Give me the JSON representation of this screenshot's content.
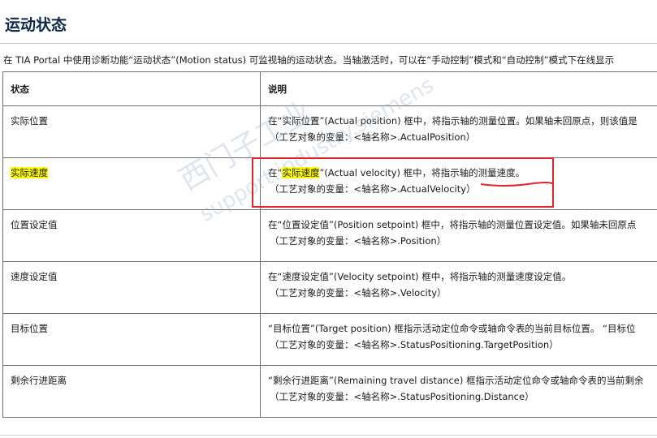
{
  "title": "运动状态",
  "intro": "在 TIA Portal 中使用诊断功能“运动状态”(Motion status) 可监视轴的运动状态。当轴激活时，可以在“手动控制”模式和“自动控制”模式下在线显示",
  "table": {
    "headers": [
      "状态",
      "说明"
    ],
    "rows": [
      {
        "status": "实际位置",
        "desc": "在“实际位置”(Actual position) 框中，将指示轴的测量位置。如果轴未回原点，则该值是",
        "var": "（工艺对象的变量：<轴名称>.ActualPosition）"
      },
      {
        "status": "实际速度",
        "desc_pre": "在“",
        "desc_hl": "实际速度",
        "desc_post": "”(Actual velocity) 框中，将指示轴的测量速度。",
        "var": "（工艺对象的变量：<轴名称>.ActualVelocity）"
      },
      {
        "status": "位置设定值",
        "desc": "在“位置设定值”(Position setpoint) 框中，将指示轴的测量位置设定值。如果轴未回原点",
        "var": "（工艺对象的变量：<轴名称>.Position）"
      },
      {
        "status": "速度设定值",
        "desc": "在“速度设定值”(Velocity setpoint) 框中，将指示轴的测量速度设定值。",
        "var": "（工艺对象的变量：<轴名称>.Velocity）"
      },
      {
        "status": "目标位置",
        "desc": "“目标位置”(Target position) 框指示活动定位命令或轴命令表的当前目标位置。 “目标位",
        "var": "（工艺对象的变量：<轴名称>.StatusPositioning.TargetPosition）"
      },
      {
        "status": "剩余行进距离",
        "desc": "“剩余行进距离”(Remaining travel distance) 框指示活动定位命令或轴命令表的当前剩余",
        "var": "（工艺对象的变量：<轴名称>.StatusPositioning.Distance）"
      }
    ]
  },
  "watermark": {
    "line1": "西门子工业",
    "line2": "support.industry.siemens"
  },
  "colors": {
    "highlight": "#ffff00",
    "annotation": "#e0262c",
    "title": "#10294a"
  }
}
